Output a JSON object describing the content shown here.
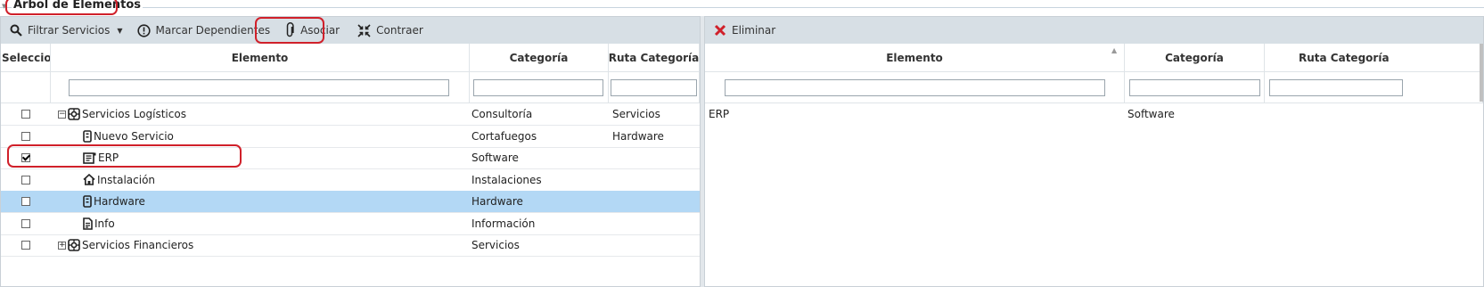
{
  "title": "Arbol de Elementos",
  "left_toolbar": {
    "filter_label": "Filtrar Servicios",
    "mark_label": "Marcar Dependientes",
    "associate_label": "Asociar",
    "collapse_label": "Contraer"
  },
  "left_table": {
    "headers": [
      "Seleccione",
      "Elemento",
      "Categoría",
      "Ruta Categoría"
    ],
    "rows": [
      {
        "checked": false,
        "selected": false,
        "expander": "−",
        "icon": "service-group-icon",
        "element": "Servicios Logísticos",
        "category": "Consultoría",
        "path": "Servicios"
      },
      {
        "checked": false,
        "selected": false,
        "expander": "",
        "icon": "device-icon",
        "element": "Nuevo Servicio",
        "category": "Cortafuegos",
        "path": "Hardware"
      },
      {
        "checked": true,
        "selected": false,
        "expander": "",
        "icon": "software-icon",
        "element": "ERP",
        "category": "Software",
        "path": ""
      },
      {
        "checked": false,
        "selected": false,
        "expander": "",
        "icon": "home-icon",
        "element": "Instalación",
        "category": "Instalaciones",
        "path": ""
      },
      {
        "checked": false,
        "selected": true,
        "expander": "",
        "icon": "device-icon",
        "element": "Hardware",
        "category": "Hardware",
        "path": ""
      },
      {
        "checked": false,
        "selected": false,
        "expander": "",
        "icon": "document-icon",
        "element": "Info",
        "category": "Información",
        "path": ""
      },
      {
        "checked": false,
        "selected": false,
        "expander": "+",
        "icon": "service-group-icon",
        "element": "Servicios Financieros",
        "category": "Servicios",
        "path": ""
      }
    ]
  },
  "right_toolbar": {
    "delete_label": "Eliminar"
  },
  "right_table": {
    "headers": [
      "Elemento",
      "Categoría",
      "Ruta Categoría"
    ],
    "rows": [
      {
        "element": "ERP",
        "category": "Software",
        "path": ""
      }
    ]
  },
  "colors": {
    "accent_red": "#d0202a",
    "selected_row": "#b3d8f5",
    "toolbar_bg": "#d7dfe5"
  }
}
